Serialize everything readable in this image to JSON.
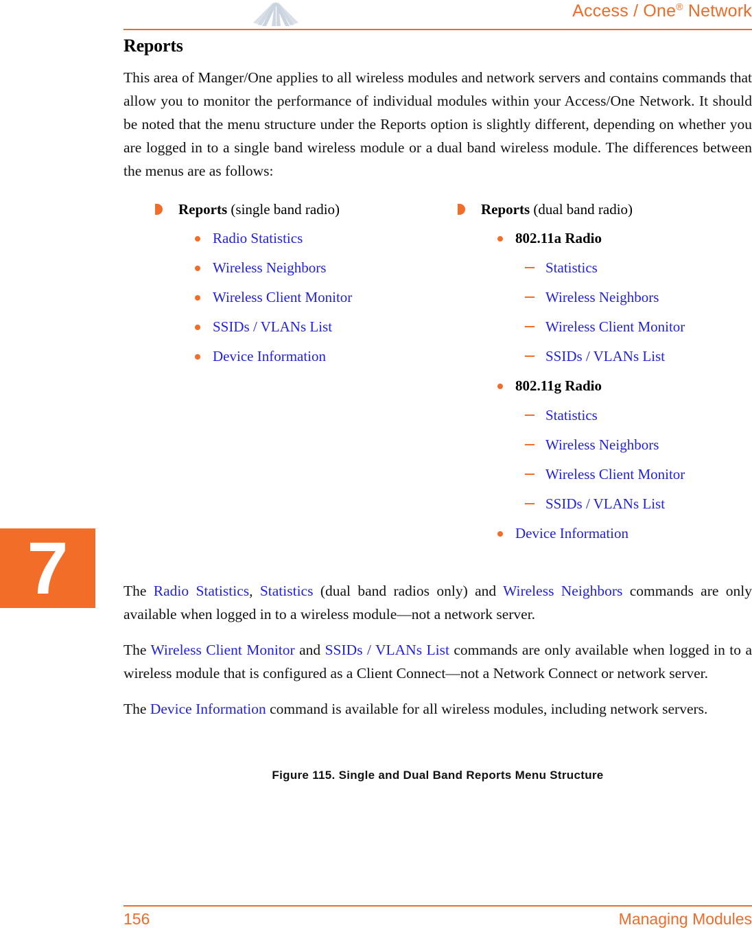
{
  "header": {
    "title_main": "Access / One",
    "title_sup": "®",
    "title_tail": " Network",
    "logo_icon": "fan-burst-logo"
  },
  "chapter_tab": {
    "number": "7"
  },
  "section": {
    "title": "Reports",
    "intro": "This area of Manger/One applies to all wireless modules and network servers and contains commands that allow you to monitor the performance of individual modules within your Access/One Network. It should be noted that the menu structure under the Reports option is slightly different, depending on whether you are logged in to a single band wireless module or a dual band wireless module. The differences between the menus are as follows:"
  },
  "figure": {
    "caption": "Figure 115. Single and Dual Band Reports Menu Structure",
    "left_column": {
      "heading_bold": "Reports",
      "heading_rest": " (single band radio)",
      "items": [
        "Radio Statistics",
        "Wireless Neighbors",
        "Wireless Client Monitor",
        "SSIDs / VLANs List",
        "Device Information"
      ]
    },
    "right_column": {
      "heading_bold": "Reports",
      "heading_rest": " (dual band radio)",
      "groups": [
        {
          "label": "802.11a Radio",
          "items": [
            "Statistics",
            "Wireless Neighbors",
            "Wireless Client Monitor",
            "SSIDs / VLANs List"
          ]
        },
        {
          "label": "802.11g Radio",
          "items": [
            "Statistics",
            "Wireless Neighbors",
            "Wireless Client Monitor",
            "SSIDs / VLANs List"
          ]
        }
      ],
      "trailing_item": "Device Information"
    }
  },
  "paragraphs": {
    "p1_a": "The ",
    "p1_link1": "Radio Statistics",
    "p1_b": ", ",
    "p1_link2": "Statistics",
    "p1_c": " (dual band radios only) and ",
    "p1_link3": "Wireless Neighbors",
    "p1_d": " commands are only available when logged in to a wireless module—not a network server.",
    "p2_a": "The ",
    "p2_link1": "Wireless Client Monitor",
    "p2_b": " and ",
    "p2_link2": "SSIDs / VLANs List",
    "p2_c": " commands are only available when logged in to a wireless module that is configured as a Client Connect—not a Network Connect or network server.",
    "p3_a": "The ",
    "p3_link1": "Device Information",
    "p3_b": " command is available for all wireless modules, including network servers."
  },
  "footer": {
    "page_number": "156",
    "chapter_name": "Managing Modules"
  },
  "colors": {
    "accent_orange": "#ee6b28",
    "tab_orange": "#f26d28",
    "link_blue": "#2222dd",
    "logo_gray": "#c8d2dd"
  }
}
